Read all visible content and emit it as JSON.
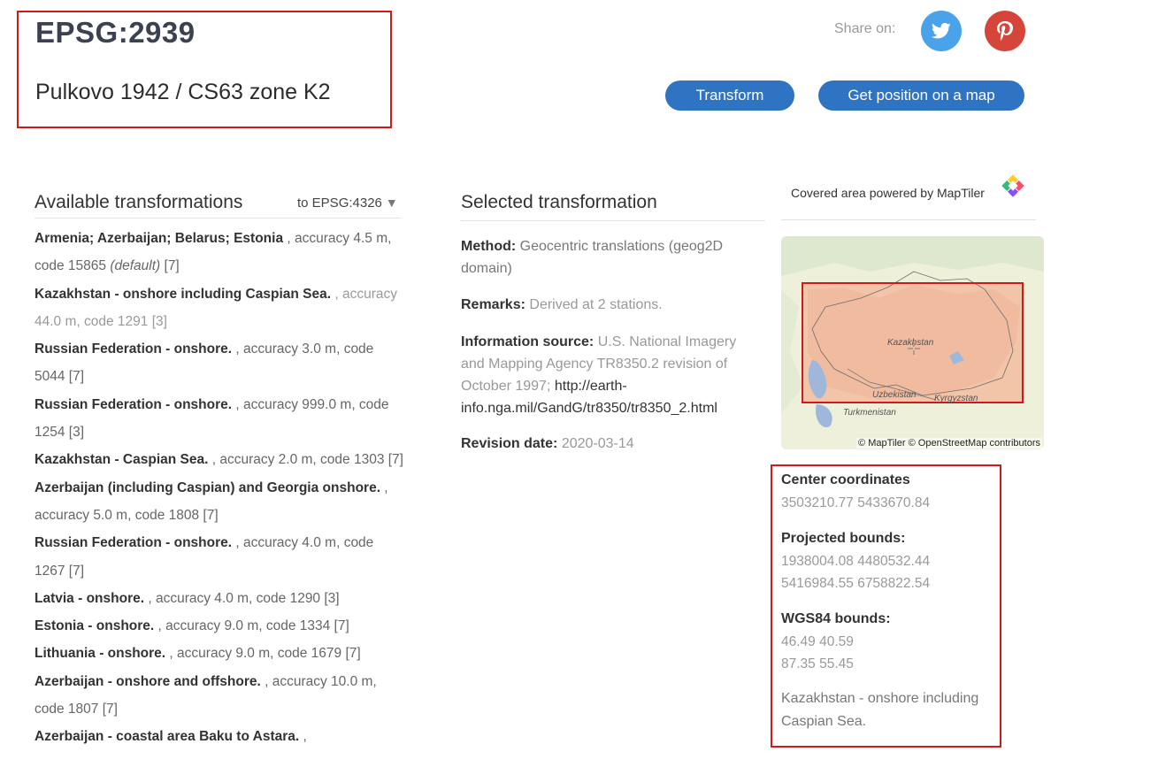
{
  "header": {
    "code": "EPSG:2939",
    "name": "Pulkovo 1942 / CS63 zone K2"
  },
  "share": {
    "label": "Share on:",
    "twitter_icon": "twitter-icon",
    "pinterest_icon": "pinterest-icon",
    "twitter_color": "#4aa3ea",
    "pinterest_color": "#d6453a"
  },
  "buttons": {
    "transform": "Transform",
    "position": "Get position on a map",
    "color": "#2f74c2"
  },
  "available": {
    "title": "Available transformations",
    "to_label": "to EPSG:4326",
    "items": [
      {
        "area": "Armenia; Azerbaijan; Belarus; Estonia",
        "rest": " , accuracy 4.5 m, code 15865 ",
        "default": "(default)",
        "ref": " [7]"
      },
      {
        "area": "Kazakhstan - onshore including Caspian Sea.",
        "rest": " , accuracy 44.0 m, code 1291 [3]",
        "muted": true
      },
      {
        "area": "Russian Federation - onshore.",
        "rest": " , accuracy 3.0 m, code 5044 [7]"
      },
      {
        "area": "Russian Federation - onshore.",
        "rest": " , accuracy 999.0 m, code 1254 [3]"
      },
      {
        "area": "Kazakhstan - Caspian Sea.",
        "rest": " , accuracy 2.0 m, code 1303 [7]"
      },
      {
        "area": "Azerbaijan (including Caspian) and Georgia onshore.",
        "rest": " , accuracy 5.0 m, code 1808 [7]"
      },
      {
        "area": "Russian Federation - onshore.",
        "rest": " , accuracy 4.0 m, code 1267 [7]"
      },
      {
        "area": "Latvia - onshore.",
        "rest": " , accuracy 4.0 m, code 1290 [3]"
      },
      {
        "area": "Estonia - onshore.",
        "rest": " , accuracy 9.0 m, code 1334 [7]"
      },
      {
        "area": "Lithuania - onshore.",
        "rest": " , accuracy 9.0 m, code 1679 [7]"
      },
      {
        "area": "Azerbaijan - onshore and offshore.",
        "rest": " , accuracy 10.0 m, code 1807 [7]"
      },
      {
        "area": "Azerbaijan - coastal area Baku to Astara.",
        "rest": " ,"
      }
    ]
  },
  "selected": {
    "title": "Selected transformation",
    "method_label": "Method:",
    "method_value": "Geocentric translations (geog2D domain)",
    "remarks_label": "Remarks:",
    "remarks_value": "Derived at 2 stations.",
    "source_label": "Information source:",
    "source_value": "U.S. National Imagery and Mapping Agency TR8350.2 revision of October 1997;",
    "source_link": "http://earth-info.nga.mil/GandG/tr8350/tr8350_2.html",
    "revision_label": "Revision date:",
    "revision_value": "2020-03-14"
  },
  "map": {
    "powered_label": "Covered area powered by MapTiler",
    "logo_icon": "maptiler-logo-icon",
    "attribution": "© MapTiler © OpenStreetMap contributors",
    "labels": {
      "kazakhstan": "Kazakhstan",
      "uzbekistan": "Uzbekistan",
      "kyrgyzstan": "Kyrgyzstan",
      "turkmenistan": "Turkmenistan"
    },
    "highlight_color": "#d0191b"
  },
  "info": {
    "center_label": "Center coordinates",
    "center_value": "3503210.77 5433670.84",
    "projected_label": "Projected bounds:",
    "projected_line1": "1938004.08 4480532.44",
    "projected_line2": "5416984.55 6758822.54",
    "wgs_label": "WGS84 bounds:",
    "wgs_line1": "46.49 40.59",
    "wgs_line2": "87.35 55.45",
    "area": "Kazakhstan - onshore including Caspian Sea."
  }
}
